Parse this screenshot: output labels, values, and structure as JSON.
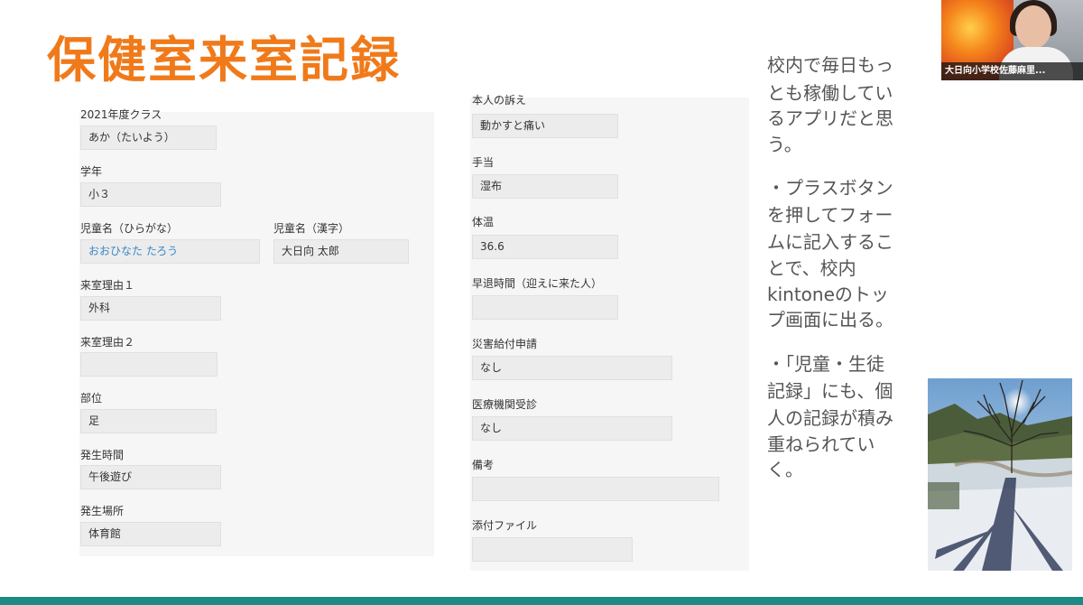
{
  "slide": {
    "title": "保健室来室記録"
  },
  "form": {
    "left": [
      {
        "label": "2021年度クラス",
        "value": "あか（たいよう）"
      },
      {
        "label": "学年",
        "value": "小３"
      },
      {
        "label": "児童名（ひらがな）",
        "value": "おおひなた たろう"
      },
      {
        "label": "児童名（漢字）",
        "value": "大日向 太郎"
      },
      {
        "label": "来室理由１",
        "value": "外科"
      },
      {
        "label": "来室理由２",
        "value": ""
      },
      {
        "label": "部位",
        "value": "足"
      },
      {
        "label": "発生時間",
        "value": "午後遊び"
      },
      {
        "label": "発生場所",
        "value": "体育館"
      }
    ],
    "right": [
      {
        "label": "本人の訴え",
        "value": "動かすと痛い"
      },
      {
        "label": "手当",
        "value": "湿布"
      },
      {
        "label": "体温",
        "value": "36.6"
      },
      {
        "label": "早退時間（迎えに来た人）",
        "value": ""
      },
      {
        "label": "災害給付申請",
        "value": "なし"
      },
      {
        "label": "医療機関受診",
        "value": "なし"
      },
      {
        "label": "備考",
        "value": ""
      },
      {
        "label": "添付ファイル",
        "value": ""
      }
    ]
  },
  "notes": {
    "lines": [
      "校内で毎日もっ",
      "とも稼働してい",
      "るアプリだと思",
      "う。",
      "・プラスボタン",
      "を押してフォー",
      "ムに記入するこ",
      "とで、校内",
      "kintoneのトッ",
      "プ画面に出る。",
      "・「児童・生徒",
      "記録」にも、個",
      "人の記録が積み",
      "重ねられてい",
      "く。"
    ]
  },
  "video": {
    "participant_name": "大日向小学校佐藤麻里..."
  },
  "colors": {
    "title": "#f07a1a",
    "link_value": "#3a87c8",
    "bottom_bar": "#1d8a85"
  }
}
